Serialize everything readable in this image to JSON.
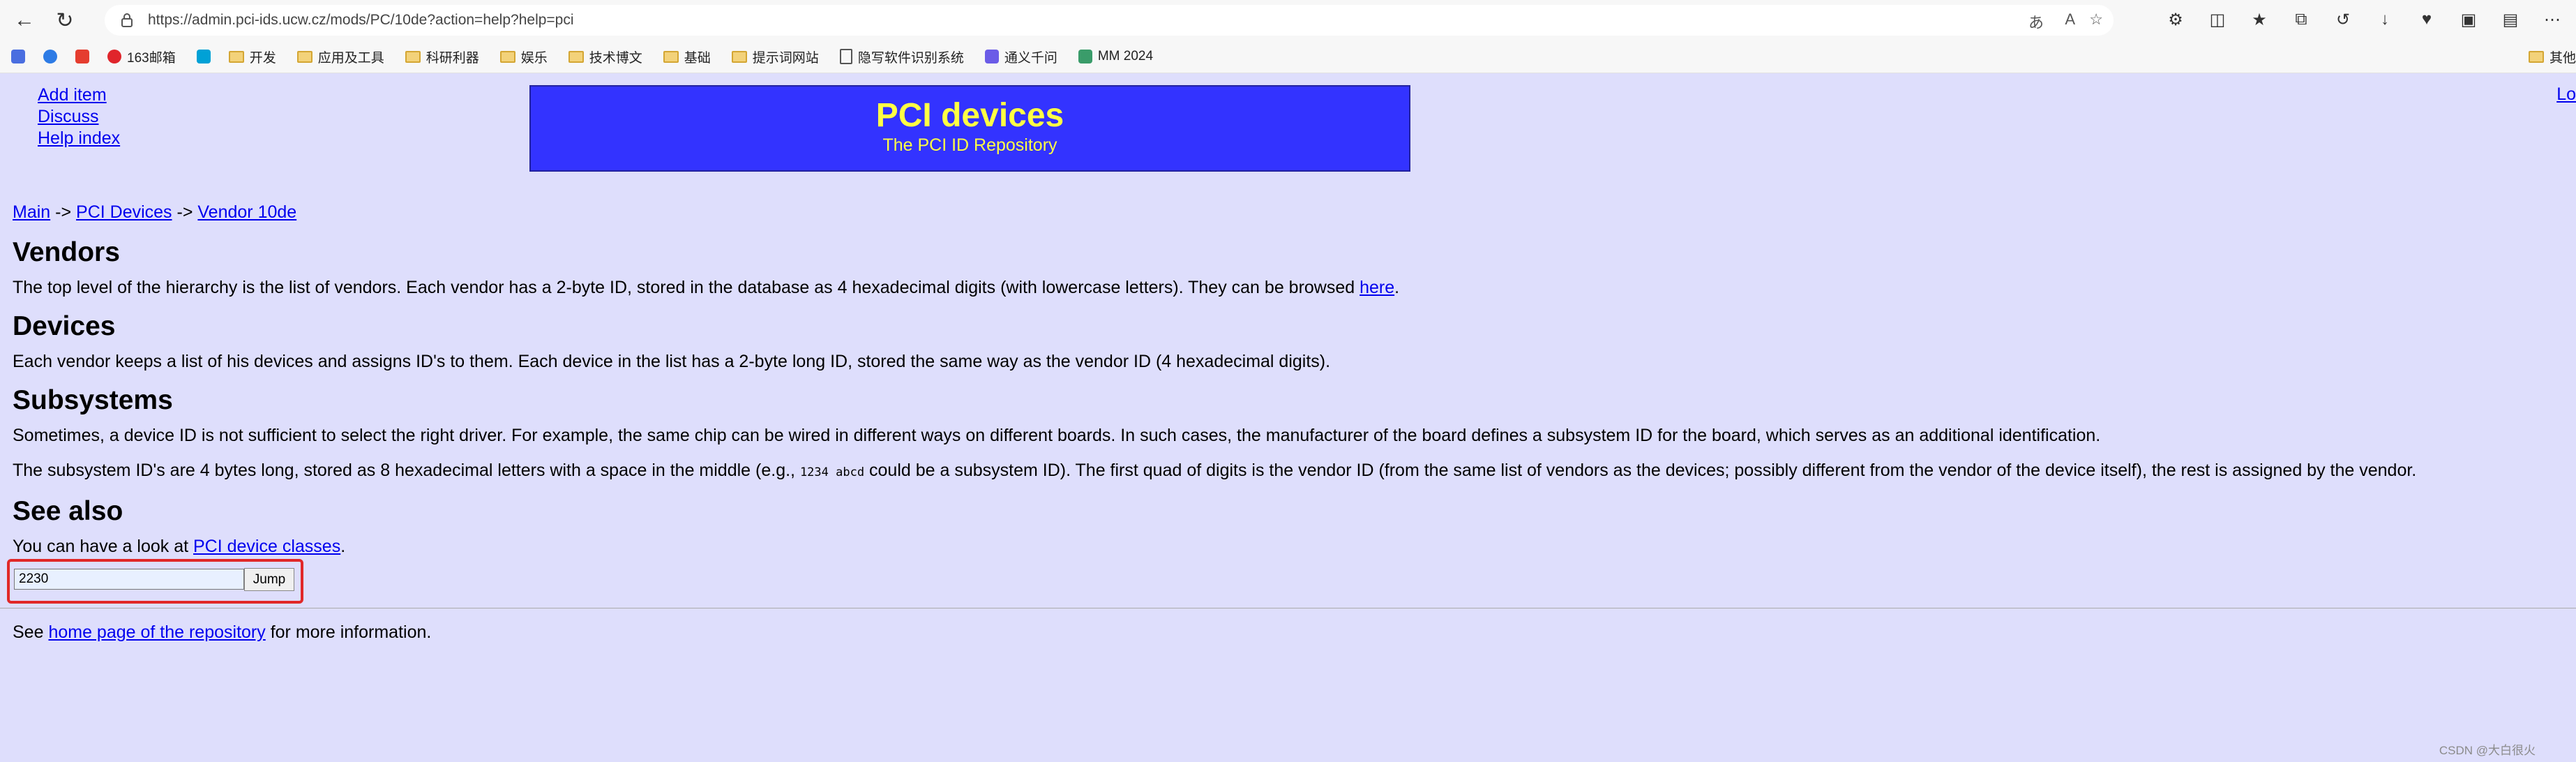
{
  "browser": {
    "url": "https://admin.pci-ids.ucw.cz/mods/PC/10de?action=help?help=pci",
    "bookmarks": [
      "163邮箱",
      "开发",
      "应用及工具",
      "科研利器",
      "娱乐",
      "技术博文",
      "基础",
      "提示词网站",
      "隐写软件识别系统",
      "通义千问",
      "MM 2024"
    ],
    "other_bookmarks": "其他"
  },
  "side_links": [
    "Add item",
    "Discuss",
    "Help index"
  ],
  "logo": {
    "title": "PCI devices",
    "subtitle": "The PCI ID Repository"
  },
  "login_link": "Lo",
  "breadcrumb": {
    "main": "Main",
    "sep": " -> ",
    "devices": "PCI Devices",
    "vendor": "Vendor 10de"
  },
  "sections": {
    "vendors": {
      "heading": "Vendors",
      "text": "The top level of the hierarchy is the list of vendors. Each vendor has a 2-byte ID, stored in the database as 4 hexadecimal digits (with lowercase letters). They can be browsed ",
      "link": "here",
      "after": "."
    },
    "devices": {
      "heading": "Devices",
      "text": "Each vendor keeps a list of his devices and assigns ID's to them. Each device in the list has a 2-byte long ID, stored the same way as the vendor ID (4 hexadecimal digits)."
    },
    "subsystems": {
      "heading": "Subsystems",
      "p1": "Sometimes, a device ID is not sufficient to select the right driver. For example, the same chip can be wired in different ways on different boards. In such cases, the manufacturer of the board defines a subsystem ID for the board, which serves as an additional identification.",
      "p2a": "The subsystem ID's are 4 bytes long, stored as 8 hexadecimal letters with a space in the middle (e.g., ",
      "code": "1234 abcd",
      "p2b": " could be a subsystem ID). The first quad of digits is the vendor ID (from the same list of vendors as the devices; possibly different from the vendor of the device itself), the rest is assigned by the vendor."
    },
    "see_also": {
      "heading": "See also",
      "text": "You can have a look at ",
      "link": "PCI device classes",
      "after": "."
    }
  },
  "jump": {
    "value": "2230",
    "button": "Jump"
  },
  "footer": {
    "before": "See ",
    "link": "home page of the repository",
    "after": " for more information."
  },
  "watermark": "CSDN @大白很火"
}
